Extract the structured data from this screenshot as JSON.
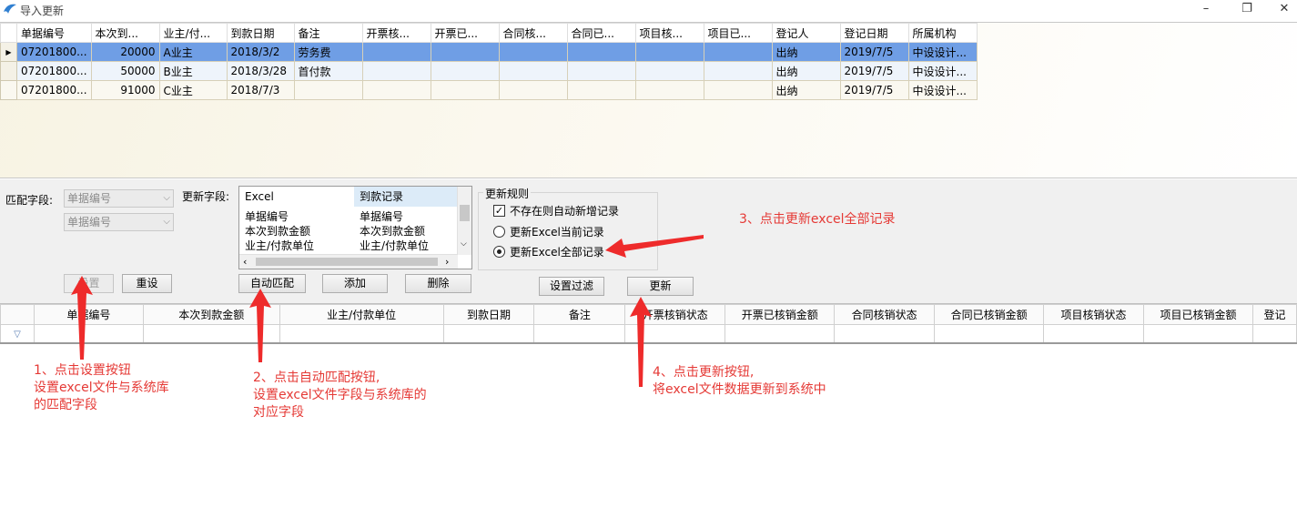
{
  "window": {
    "title": "导入更新",
    "minimize": "–",
    "restore": "❐",
    "close": "✕"
  },
  "top_grid": {
    "columns": [
      "单据编号",
      "本次到...",
      "业主/付...",
      "到款日期",
      "备注",
      "开票核...",
      "开票已...",
      "合同核...",
      "合同已...",
      "项目核...",
      "项目已...",
      "登记人",
      "登记日期",
      "所属机构"
    ],
    "rows": [
      [
        "07201800...",
        "20000",
        "A业主",
        "2018/3/2",
        "劳务费",
        "",
        "",
        "",
        "",
        "",
        "",
        "出纳",
        "2019/7/5",
        "中设设计..."
      ],
      [
        "07201800...",
        "50000",
        "B业主",
        "2018/3/28",
        "首付款",
        "",
        "",
        "",
        "",
        "",
        "",
        "出纳",
        "2019/7/5",
        "中设设计..."
      ],
      [
        "07201800...",
        "91000",
        "C业主",
        "2018/7/3",
        "",
        "",
        "",
        "",
        "",
        "",
        "",
        "出纳",
        "2019/7/5",
        "中设设计..."
      ]
    ],
    "row_indicator": "▶"
  },
  "match": {
    "label": "匹配字段:",
    "combo1": "单据编号",
    "combo2": "单据编号",
    "set_button": "设置",
    "reset_button": "重设"
  },
  "update_fields": {
    "label": "更新字段:",
    "col_excel": "Excel",
    "col_target": "到款记录",
    "rows": [
      [
        "单据编号",
        "单据编号"
      ],
      [
        "本次到款金额",
        "本次到款金额"
      ],
      [
        "业主/付款单位",
        "业主/付款单位"
      ]
    ],
    "auto_match_button": "自动匹配",
    "add_button": "添加",
    "delete_button": "删除"
  },
  "rules": {
    "legend": "更新规则",
    "checkbox_label": "不存在则自动新增记录",
    "checkbox_checked": true,
    "radio_current": "更新Excel当前记录",
    "radio_all": "更新Excel全部记录",
    "selected": "all"
  },
  "filter_button": "设置过滤",
  "update_button": "更新",
  "bottom_grid": {
    "columns": [
      "单据编号",
      "本次到款金额",
      "业主/付款单位",
      "到款日期",
      "备注",
      "开票核销状态",
      "开票已核销金额",
      "合同核销状态",
      "合同已核销金额",
      "项目核销状态",
      "项目已核销金额",
      "登记"
    ],
    "filter_icon": "▽"
  },
  "annotations": {
    "step1": [
      "1、点击设置按钮",
      "设置excel文件与系统库",
      "的匹配字段"
    ],
    "step2": [
      "2、点击自动匹配按钮,",
      "设置excel文件字段与系统库的",
      "对应字段"
    ],
    "step3": [
      "3、点击更新excel全部记录"
    ],
    "step4": [
      "4、点击更新按钮,",
      "将excel文件数据更新到系统中"
    ]
  },
  "colors": {
    "selected_row": "#6f9ee5",
    "annotation": "#e53935"
  }
}
